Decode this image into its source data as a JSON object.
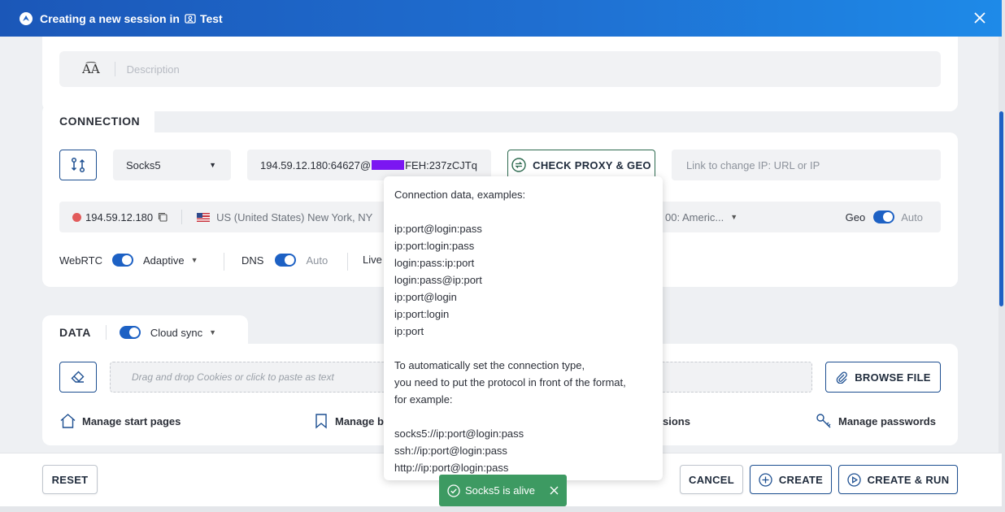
{
  "window": {
    "title": "Creating a new session in",
    "workspace": "Test"
  },
  "description": {
    "icon": "A͡A",
    "placeholder": "Description"
  },
  "connection": {
    "section_title": "CONNECTION",
    "proxy_type": "Socks5",
    "proxy_value_start": "194.59.12.180:64627@",
    "proxy_value_end": "FEH:237zCJTq",
    "check_button": "CHECK PROXY & GEO",
    "change_ip_placeholder": "Link to change IP: URL or IP",
    "ip": "194.59.12.180",
    "location": "US (United States) New York, NY",
    "timezone": "00: Americ...",
    "geo_label": "Geo",
    "geo_mode": "Auto",
    "webrtc_label": "WebRTC",
    "webrtc_mode": "Adaptive",
    "dns_label": "DNS",
    "dns_mode": "Auto",
    "live_label": "Live"
  },
  "data": {
    "section_title": "DATA",
    "cloud_sync": "Cloud sync",
    "cookies_placeholder": "Drag and drop Cookies or click to paste as text",
    "browse_button": "BROWSE FILE",
    "manage_start_pages": "Manage start pages",
    "manage_bookmarks": "Manage b",
    "manage_extensions": "sions",
    "manage_passwords": "Manage passwords"
  },
  "tooltip": {
    "heading": "Connection data, examples:",
    "formats": [
      "ip:port@login:pass",
      "ip:port:login:pass",
      "login:pass:ip:port",
      "login:pass@ip:port",
      "ip:port@login",
      "ip:port:login",
      "ip:port"
    ],
    "note_lines": [
      "To automatically set the connection type,",
      "you need to put the protocol in front of the format,",
      "for example:"
    ],
    "examples": [
      "socks5://ip:port@login:pass",
      "ssh://ip:port@login:pass",
      "http://ip:port@login:pass"
    ]
  },
  "footer": {
    "reset": "RESET",
    "cancel": "CANCEL",
    "create": "CREATE",
    "create_run": "CREATE & RUN"
  },
  "toast": {
    "message": "Socks5 is alive"
  },
  "colors": {
    "accent": "#1d61c4",
    "toast": "#3d9a62",
    "redaction": "#7b16f2"
  }
}
